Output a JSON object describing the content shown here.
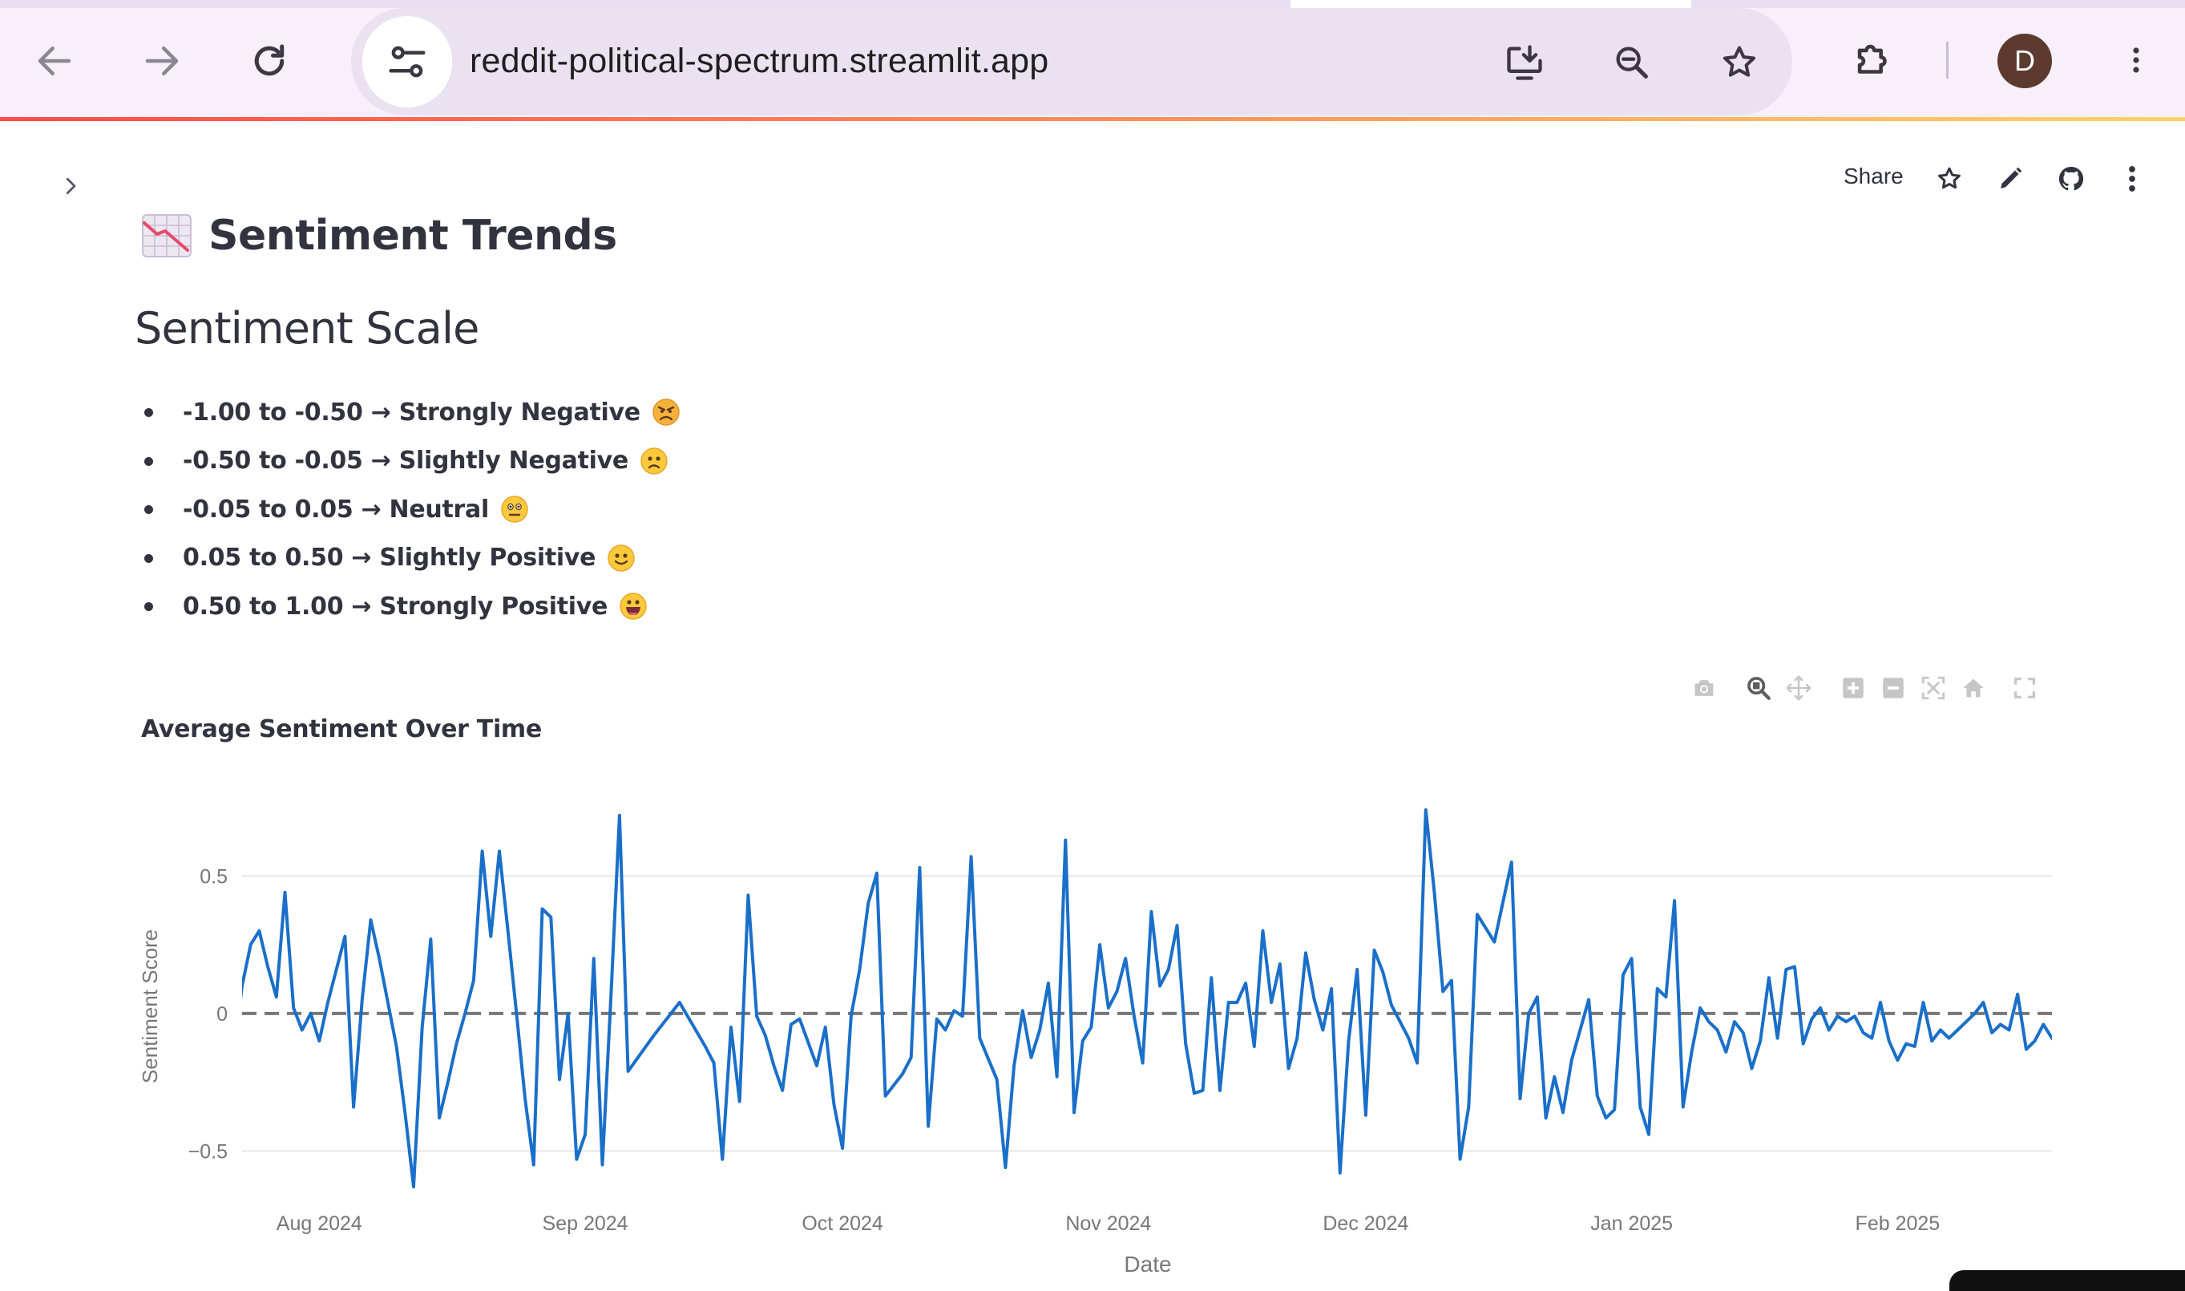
{
  "browser": {
    "url": "reddit-political-spectrum.streamlit.app",
    "profile_initial": "D"
  },
  "header": {
    "share_label": "Share"
  },
  "page": {
    "title": "Sentiment Trends",
    "title_icon": "chart-decreasing-emoji",
    "section_heading": "Sentiment Scale",
    "scale_items": [
      {
        "text": "-1.00 to -0.50 → Strongly Negative",
        "emoji": "angry-face"
      },
      {
        "text": "-0.50 to -0.05 → Slightly Negative",
        "emoji": "slightly-frowning-face"
      },
      {
        "text": "-0.05 to 0.05 → Neutral",
        "emoji": "neutral-face"
      },
      {
        "text": "0.05 to 0.50 → Slightly Positive",
        "emoji": "slightly-smiling-face"
      },
      {
        "text": "0.50 to 1.00 → Strongly Positive",
        "emoji": "grinning-face"
      }
    ]
  },
  "colors": {
    "accent_line": "#1a6fc9",
    "zero_line": "#777777",
    "text": "#31333f",
    "avatar_bg": "#5c3a2e"
  },
  "chart_data": {
    "type": "line",
    "title": "Average Sentiment Over Time",
    "xlabel": "Date",
    "ylabel": "Sentiment Score",
    "x_range": [
      "2024-07-23",
      "2025-02-19"
    ],
    "ylim": [
      -0.63,
      0.74
    ],
    "x_ticks": [
      "Aug 2024",
      "Sep 2024",
      "Oct 2024",
      "Nov 2024",
      "Dec 2024",
      "Jan 2025",
      "Feb 2025"
    ],
    "y_ticks": [
      "0.5",
      "0",
      "−0.5"
    ],
    "y_tick_values": [
      0.5,
      0,
      -0.5
    ],
    "reference_line": 0,
    "grid": true,
    "series": [
      {
        "points": [
          [
            "2024-07-22",
            -0.16
          ],
          [
            "2024-07-23",
            0.1
          ],
          [
            "2024-07-24",
            0.25
          ],
          [
            "2024-07-25",
            0.3
          ],
          [
            "2024-07-26",
            0.17
          ],
          [
            "2024-07-27",
            0.06
          ],
          [
            "2024-07-28",
            0.44
          ],
          [
            "2024-07-29",
            0.02
          ],
          [
            "2024-07-30",
            -0.06
          ],
          [
            "2024-07-31",
            -0.0
          ],
          [
            "2024-08-01",
            -0.1
          ],
          [
            "2024-08-02",
            0.04
          ],
          [
            "2024-08-03",
            0.16
          ],
          [
            "2024-08-04",
            0.28
          ],
          [
            "2024-08-05",
            -0.34
          ],
          [
            "2024-08-06",
            0.05
          ],
          [
            "2024-08-07",
            0.34
          ],
          [
            "2024-08-08",
            0.2
          ],
          [
            "2024-08-09",
            0.04
          ],
          [
            "2024-08-10",
            -0.12
          ],
          [
            "2024-08-11",
            -0.36
          ],
          [
            "2024-08-12",
            -0.63
          ],
          [
            "2024-08-13",
            -0.05
          ],
          [
            "2024-08-14",
            0.27
          ],
          [
            "2024-08-15",
            -0.38
          ],
          [
            "2024-08-16",
            -0.25
          ],
          [
            "2024-08-17",
            -0.11
          ],
          [
            "2024-08-18",
            0.0
          ],
          [
            "2024-08-19",
            0.12
          ],
          [
            "2024-08-20",
            0.59
          ],
          [
            "2024-08-21",
            0.28
          ],
          [
            "2024-08-22",
            0.59
          ],
          [
            "2024-08-23",
            0.3
          ],
          [
            "2024-08-24",
            -0.0
          ],
          [
            "2024-08-25",
            -0.31
          ],
          [
            "2024-08-26",
            -0.55
          ],
          [
            "2024-08-27",
            0.38
          ],
          [
            "2024-08-28",
            0.35
          ],
          [
            "2024-08-29",
            -0.24
          ],
          [
            "2024-08-30",
            0.0
          ],
          [
            "2024-08-31",
            -0.53
          ],
          [
            "2024-09-01",
            -0.44
          ],
          [
            "2024-09-02",
            0.2
          ],
          [
            "2024-09-03",
            -0.55
          ],
          [
            "2024-09-04",
            0.06
          ],
          [
            "2024-09-05",
            0.72
          ],
          [
            "2024-09-06",
            -0.21
          ],
          [
            "2024-09-09",
            -0.08
          ],
          [
            "2024-09-12",
            0.04
          ],
          [
            "2024-09-15",
            -0.12
          ],
          [
            "2024-09-16",
            -0.18
          ],
          [
            "2024-09-17",
            -0.53
          ],
          [
            "2024-09-18",
            -0.05
          ],
          [
            "2024-09-19",
            -0.32
          ],
          [
            "2024-09-20",
            0.43
          ],
          [
            "2024-09-21",
            -0.01
          ],
          [
            "2024-09-22",
            -0.08
          ],
          [
            "2024-09-23",
            -0.19
          ],
          [
            "2024-09-24",
            -0.28
          ],
          [
            "2024-09-25",
            -0.04
          ],
          [
            "2024-09-26",
            -0.02
          ],
          [
            "2024-09-28",
            -0.19
          ],
          [
            "2024-09-29",
            -0.05
          ],
          [
            "2024-09-30",
            -0.33
          ],
          [
            "2024-10-01",
            -0.49
          ],
          [
            "2024-10-02",
            -0.01
          ],
          [
            "2024-10-03",
            0.16
          ],
          [
            "2024-10-04",
            0.4
          ],
          [
            "2024-10-05",
            0.51
          ],
          [
            "2024-10-06",
            -0.3
          ],
          [
            "2024-10-08",
            -0.22
          ],
          [
            "2024-10-09",
            -0.16
          ],
          [
            "2024-10-10",
            0.53
          ],
          [
            "2024-10-11",
            -0.41
          ],
          [
            "2024-10-12",
            -0.02
          ],
          [
            "2024-10-13",
            -0.06
          ],
          [
            "2024-10-14",
            0.01
          ],
          [
            "2024-10-15",
            -0.01
          ],
          [
            "2024-10-16",
            0.57
          ],
          [
            "2024-10-17",
            -0.09
          ],
          [
            "2024-10-19",
            -0.24
          ],
          [
            "2024-10-20",
            -0.56
          ],
          [
            "2024-10-21",
            -0.19
          ],
          [
            "2024-10-22",
            0.01
          ],
          [
            "2024-10-23",
            -0.16
          ],
          [
            "2024-10-24",
            -0.06
          ],
          [
            "2024-10-25",
            0.11
          ],
          [
            "2024-10-26",
            -0.23
          ],
          [
            "2024-10-27",
            0.63
          ],
          [
            "2024-10-28",
            -0.36
          ],
          [
            "2024-10-29",
            -0.1
          ],
          [
            "2024-10-30",
            -0.05
          ],
          [
            "2024-10-31",
            0.25
          ],
          [
            "2024-11-01",
            0.02
          ],
          [
            "2024-11-02",
            0.08
          ],
          [
            "2024-11-03",
            0.2
          ],
          [
            "2024-11-04",
            -0.01
          ],
          [
            "2024-11-05",
            -0.18
          ],
          [
            "2024-11-06",
            0.37
          ],
          [
            "2024-11-07",
            0.1
          ],
          [
            "2024-11-08",
            0.16
          ],
          [
            "2024-11-09",
            0.32
          ],
          [
            "2024-11-10",
            -0.11
          ],
          [
            "2024-11-11",
            -0.29
          ],
          [
            "2024-11-12",
            -0.28
          ],
          [
            "2024-11-13",
            0.13
          ],
          [
            "2024-11-14",
            -0.28
          ],
          [
            "2024-11-15",
            0.04
          ],
          [
            "2024-11-16",
            0.04
          ],
          [
            "2024-11-17",
            0.11
          ],
          [
            "2024-11-18",
            -0.12
          ],
          [
            "2024-11-19",
            0.3
          ],
          [
            "2024-11-20",
            0.04
          ],
          [
            "2024-11-21",
            0.18
          ],
          [
            "2024-11-22",
            -0.2
          ],
          [
            "2024-11-23",
            -0.09
          ],
          [
            "2024-11-24",
            0.22
          ],
          [
            "2024-11-25",
            0.05
          ],
          [
            "2024-11-26",
            -0.06
          ],
          [
            "2024-11-27",
            0.09
          ],
          [
            "2024-11-28",
            -0.58
          ],
          [
            "2024-11-29",
            -0.1
          ],
          [
            "2024-11-30",
            0.16
          ],
          [
            "2024-12-01",
            -0.37
          ],
          [
            "2024-12-02",
            0.23
          ],
          [
            "2024-12-03",
            0.15
          ],
          [
            "2024-12-04",
            0.03
          ],
          [
            "2024-12-06",
            -0.09
          ],
          [
            "2024-12-07",
            -0.18
          ],
          [
            "2024-12-08",
            0.74
          ],
          [
            "2024-12-09",
            0.44
          ],
          [
            "2024-12-10",
            0.08
          ],
          [
            "2024-12-11",
            0.12
          ],
          [
            "2024-12-12",
            -0.53
          ],
          [
            "2024-12-13",
            -0.34
          ],
          [
            "2024-12-14",
            0.36
          ],
          [
            "2024-12-16",
            0.26
          ],
          [
            "2024-12-18",
            0.55
          ],
          [
            "2024-12-19",
            -0.31
          ],
          [
            "2024-12-20",
            -0.0
          ],
          [
            "2024-12-21",
            0.06
          ],
          [
            "2024-12-22",
            -0.38
          ],
          [
            "2024-12-23",
            -0.23
          ],
          [
            "2024-12-24",
            -0.36
          ],
          [
            "2024-12-25",
            -0.17
          ],
          [
            "2024-12-27",
            0.05
          ],
          [
            "2024-12-28",
            -0.3
          ],
          [
            "2024-12-29",
            -0.38
          ],
          [
            "2024-12-30",
            -0.35
          ],
          [
            "2024-12-31",
            0.14
          ],
          [
            "2025-01-01",
            0.2
          ],
          [
            "2025-01-02",
            -0.34
          ],
          [
            "2025-01-03",
            -0.44
          ],
          [
            "2025-01-04",
            0.09
          ],
          [
            "2025-01-05",
            0.06
          ],
          [
            "2025-01-06",
            0.41
          ],
          [
            "2025-01-07",
            -0.34
          ],
          [
            "2025-01-08",
            -0.14
          ],
          [
            "2025-01-09",
            0.02
          ],
          [
            "2025-01-10",
            -0.03
          ],
          [
            "2025-01-11",
            -0.06
          ],
          [
            "2025-01-12",
            -0.14
          ],
          [
            "2025-01-13",
            -0.03
          ],
          [
            "2025-01-14",
            -0.07
          ],
          [
            "2025-01-15",
            -0.2
          ],
          [
            "2025-01-16",
            -0.1
          ],
          [
            "2025-01-17",
            0.13
          ],
          [
            "2025-01-18",
            -0.09
          ],
          [
            "2025-01-19",
            0.16
          ],
          [
            "2025-01-20",
            0.17
          ],
          [
            "2025-01-21",
            -0.11
          ],
          [
            "2025-01-22",
            -0.02
          ],
          [
            "2025-01-23",
            0.02
          ],
          [
            "2025-01-24",
            -0.06
          ],
          [
            "2025-01-25",
            -0.01
          ],
          [
            "2025-01-26",
            -0.03
          ],
          [
            "2025-01-27",
            -0.01
          ],
          [
            "2025-01-28",
            -0.07
          ],
          [
            "2025-01-29",
            -0.09
          ],
          [
            "2025-01-30",
            0.04
          ],
          [
            "2025-01-31",
            -0.1
          ],
          [
            "2025-02-01",
            -0.17
          ],
          [
            "2025-02-02",
            -0.11
          ],
          [
            "2025-02-03",
            -0.12
          ],
          [
            "2025-02-04",
            0.04
          ],
          [
            "2025-02-05",
            -0.1
          ],
          [
            "2025-02-06",
            -0.06
          ],
          [
            "2025-02-07",
            -0.09
          ],
          [
            "2025-02-08",
            -0.06
          ],
          [
            "2025-02-09",
            -0.03
          ],
          [
            "2025-02-10",
            0.0
          ],
          [
            "2025-02-11",
            0.04
          ],
          [
            "2025-02-12",
            -0.07
          ],
          [
            "2025-02-13",
            -0.04
          ],
          [
            "2025-02-14",
            -0.06
          ],
          [
            "2025-02-15",
            0.07
          ],
          [
            "2025-02-16",
            -0.13
          ],
          [
            "2025-02-17",
            -0.1
          ],
          [
            "2025-02-18",
            -0.04
          ],
          [
            "2025-02-19",
            -0.09
          ],
          [
            "2025-02-20",
            -0.12
          ]
        ]
      }
    ]
  }
}
